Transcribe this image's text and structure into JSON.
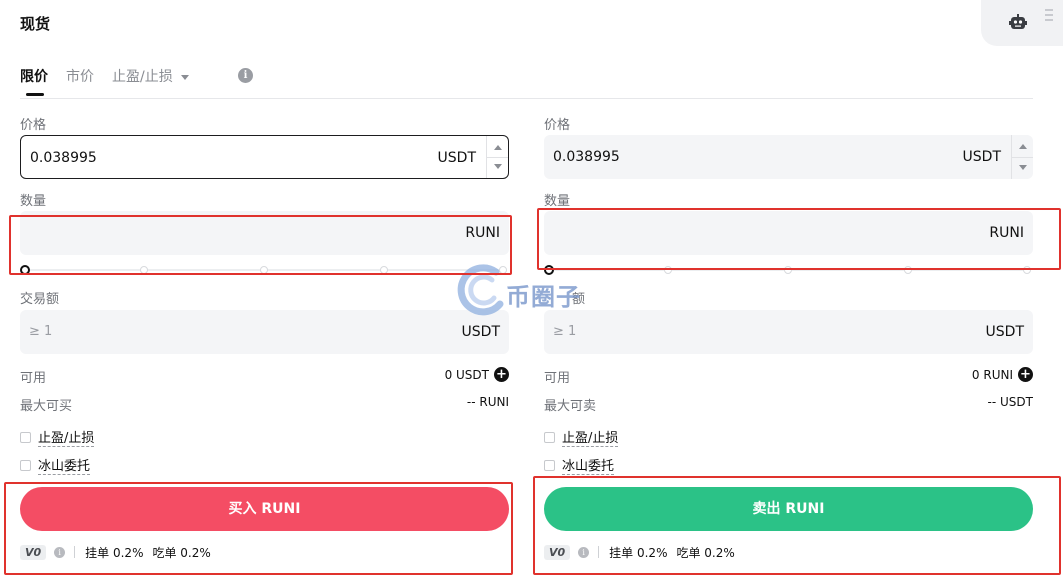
{
  "header": {
    "title": "现货"
  },
  "tabs": {
    "limit": "限价",
    "market": "市价",
    "tpsl": "止盈/止损"
  },
  "buy": {
    "price_label": "价格",
    "price_value": "0.038995",
    "price_unit": "USDT",
    "amount_label": "数量",
    "amount_unit": "RUNI",
    "total_label": "交易额",
    "total_placeholder": "≥ 1",
    "total_unit": "USDT",
    "avail_label": "可用",
    "avail_value": "0 USDT",
    "max_label": "最大可买",
    "max_value": "-- RUNI",
    "opt_tpsl": "止盈/止损",
    "opt_iceberg": "冰山委托",
    "button": "买入 RUNI",
    "vip": "V0",
    "maker_fee": "挂单 0.2%",
    "taker_fee": "吃单 0.2%"
  },
  "sell": {
    "price_label": "价格",
    "price_value": "0.038995",
    "price_unit": "USDT",
    "amount_label": "数量",
    "amount_unit": "RUNI",
    "total_label": "额",
    "total_placeholder": "≥ 1",
    "total_unit": "USDT",
    "avail_label": "可用",
    "avail_value": "0 RUNI",
    "max_label": "最大可卖",
    "max_value": "-- USDT",
    "opt_tpsl": "止盈/止损",
    "opt_iceberg": "冰山委托",
    "button": "卖出 RUNI",
    "vip": "V0",
    "maker_fee": "挂单 0.2%",
    "taker_fee": "吃单 0.2%"
  },
  "watermark": {
    "text": "币圈子"
  },
  "colors": {
    "buy": "#f44d64",
    "sell": "#2bc287",
    "highlight": "#e0322d"
  },
  "icons": [
    "bot-icon",
    "menu-icon",
    "info-icon",
    "plus-icon",
    "stepper-up-icon",
    "stepper-down-icon"
  ]
}
